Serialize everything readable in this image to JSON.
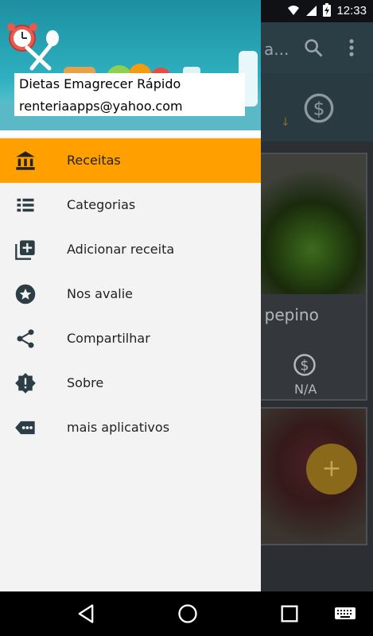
{
  "status_bar": {
    "time": "12:33"
  },
  "background_app": {
    "title_fragment": "a...",
    "card1": {
      "title_fragment": "e pepino",
      "price": "N/A"
    },
    "fab_label": "+"
  },
  "drawer": {
    "header": {
      "app_name": "Dietas Emagrecer Rápido",
      "email": "renteriaapps@yahoo.com"
    },
    "menu_items": [
      {
        "label": "Receitas",
        "icon": "bank-icon",
        "selected": true
      },
      {
        "label": "Categorias",
        "icon": "list-icon",
        "selected": false
      },
      {
        "label": "Adicionar receita",
        "icon": "add-box-icon",
        "selected": false
      },
      {
        "label": "Nos avalie",
        "icon": "star-circle-icon",
        "selected": false
      },
      {
        "label": "Compartilhar",
        "icon": "share-icon",
        "selected": false
      },
      {
        "label": "Sobre",
        "icon": "info-badge-icon",
        "selected": false
      },
      {
        "label": "mais aplicativos",
        "icon": "more-tag-icon",
        "selected": false
      }
    ],
    "accent_color": "#ffa000"
  },
  "nav_bar": {
    "buttons": [
      "back-icon",
      "home-icon",
      "recent-apps-icon",
      "keyboard-icon"
    ]
  }
}
